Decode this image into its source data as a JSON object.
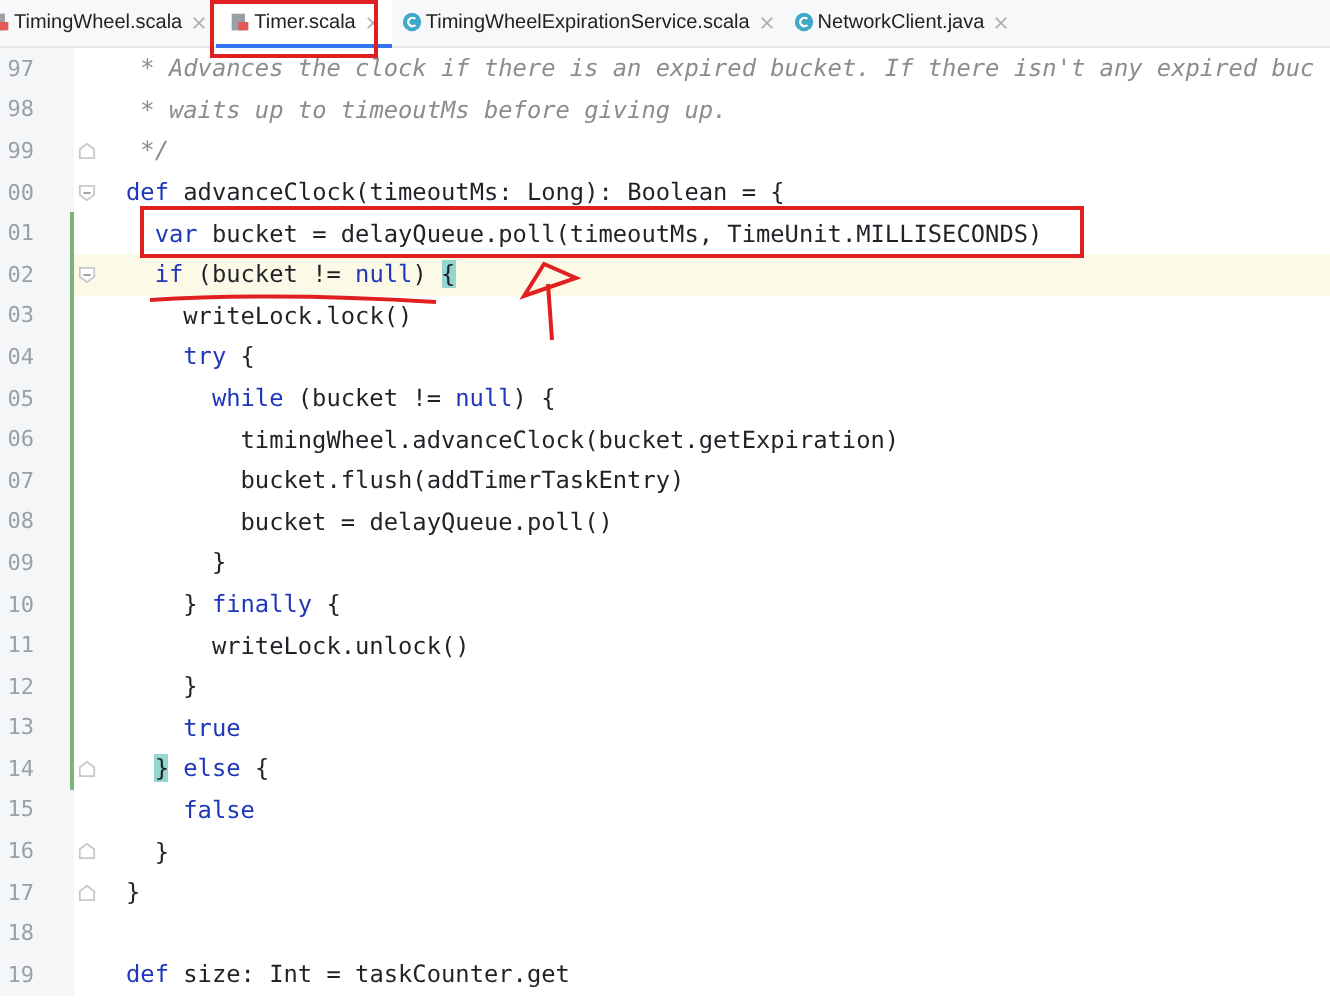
{
  "tabs": [
    {
      "label": "TimingWheel.scala",
      "kind": "scala",
      "selected": false
    },
    {
      "label": "Timer.scala",
      "kind": "scala",
      "selected": true
    },
    {
      "label": "TimingWheelExpirationService.scala",
      "kind": "class",
      "selected": false
    },
    {
      "label": "NetworkClient.java",
      "kind": "class",
      "selected": false
    }
  ],
  "lines": [
    {
      "number": "97",
      "tokens": [
        {
          "kind": "comment",
          "text": " * Advances the clock if there is an expired bucket. If there isn't any expired buc"
        }
      ]
    },
    {
      "number": "98",
      "tokens": [
        {
          "kind": "comment",
          "text": " * waits up to timeoutMs before giving up."
        }
      ]
    },
    {
      "number": "99",
      "fold_close": true,
      "tokens": [
        {
          "kind": "comment",
          "text": " */"
        }
      ]
    },
    {
      "number": "00",
      "fold_open": true,
      "tokens": [
        {
          "kind": "keyword",
          "text": "def"
        },
        {
          "kind": "plain",
          "text": " advanceClock(timeoutMs: Long): Boolean = {"
        }
      ],
      "children": [
        {
          "number": "01",
          "changed": true,
          "tokens": [
            {
              "kind": "keyword",
              "text": "var"
            },
            {
              "kind": "plain",
              "text": " bucket = delayQueue.poll(timeoutMs, TimeUnit.MILLISECONDS)"
            }
          ]
        },
        {
          "number": "02",
          "changed": true,
          "current": true,
          "fold_open": true,
          "tokens": [
            {
              "kind": "keyword",
              "text": "if"
            },
            {
              "kind": "plain",
              "text": " (bucket != "
            },
            {
              "kind": "keyword",
              "text": "null"
            },
            {
              "kind": "plain",
              "text": ") "
            },
            {
              "kind": "brace",
              "text": "{"
            }
          ],
          "children": [
            {
              "number": "03",
              "changed": true,
              "tokens": [
                {
                  "kind": "plain",
                  "text": "writeLock.lock()"
                }
              ]
            },
            {
              "number": "04",
              "changed": true,
              "tokens": [
                {
                  "kind": "keyword",
                  "text": "try"
                },
                {
                  "kind": "plain",
                  "text": " {"
                }
              ],
              "children": [
                {
                  "number": "05",
                  "changed": true,
                  "tokens": [
                    {
                      "kind": "keyword",
                      "text": "while"
                    },
                    {
                      "kind": "plain",
                      "text": " (bucket != "
                    },
                    {
                      "kind": "keyword",
                      "text": "null"
                    },
                    {
                      "kind": "plain",
                      "text": ") {"
                    }
                  ],
                  "children": [
                    {
                      "number": "06",
                      "changed": true,
                      "tokens": [
                        {
                          "kind": "plain",
                          "text": "timingWheel.advanceClock(bucket.getExpiration)"
                        }
                      ]
                    },
                    {
                      "number": "07",
                      "changed": true,
                      "tokens": [
                        {
                          "kind": "plain",
                          "text": "bucket.flush(addTimerTaskEntry)"
                        }
                      ]
                    },
                    {
                      "number": "08",
                      "changed": true,
                      "tokens": [
                        {
                          "kind": "plain",
                          "text": "bucket = delayQueue.poll()"
                        }
                      ]
                    }
                  ]
                },
                {
                  "number": "09",
                  "changed": true,
                  "tokens": [
                    {
                      "kind": "plain",
                      "text": "}"
                    }
                  ]
                }
              ]
            },
            {
              "number": "10",
              "changed": true,
              "tokens": [
                {
                  "kind": "plain",
                  "text": "}"
                },
                {
                  "kind": "keyword",
                  "text": " finally"
                },
                {
                  "kind": "plain",
                  "text": " {"
                }
              ],
              "children": [
                {
                  "number": "11",
                  "changed": true,
                  "tokens": [
                    {
                      "kind": "plain",
                      "text": "writeLock.unlock()"
                    }
                  ]
                }
              ]
            },
            {
              "number": "12",
              "changed": true,
              "tokens": [
                {
                  "kind": "plain",
                  "text": "}"
                }
              ]
            },
            {
              "number": "13",
              "changed": true,
              "tokens": [
                {
                  "kind": "keyword",
                  "text": "true"
                }
              ]
            }
          ]
        },
        {
          "number": "14",
          "changed": true,
          "fold_close": true,
          "tokens": [
            {
              "kind": "brace",
              "text": "}"
            },
            {
              "kind": "keyword",
              "text": " else"
            },
            {
              "kind": "plain",
              "text": " {"
            }
          ],
          "children": [
            {
              "number": "15",
              "tokens": [
                {
                  "kind": "keyword",
                  "text": "false"
                }
              ]
            }
          ]
        },
        {
          "number": "16",
          "fold_close": true,
          "tokens": [
            {
              "kind": "plain",
              "text": "}"
            }
          ]
        }
      ]
    },
    {
      "number": "17",
      "fold_close": true,
      "tokens": [
        {
          "kind": "plain",
          "text": "}"
        }
      ]
    },
    {
      "number": "18"
    },
    {
      "number": "19",
      "tokens": [
        {
          "kind": "keyword",
          "text": "def"
        },
        {
          "kind": "plain",
          "text": " size: Int = taskCounter.get"
        }
      ]
    }
  ]
}
